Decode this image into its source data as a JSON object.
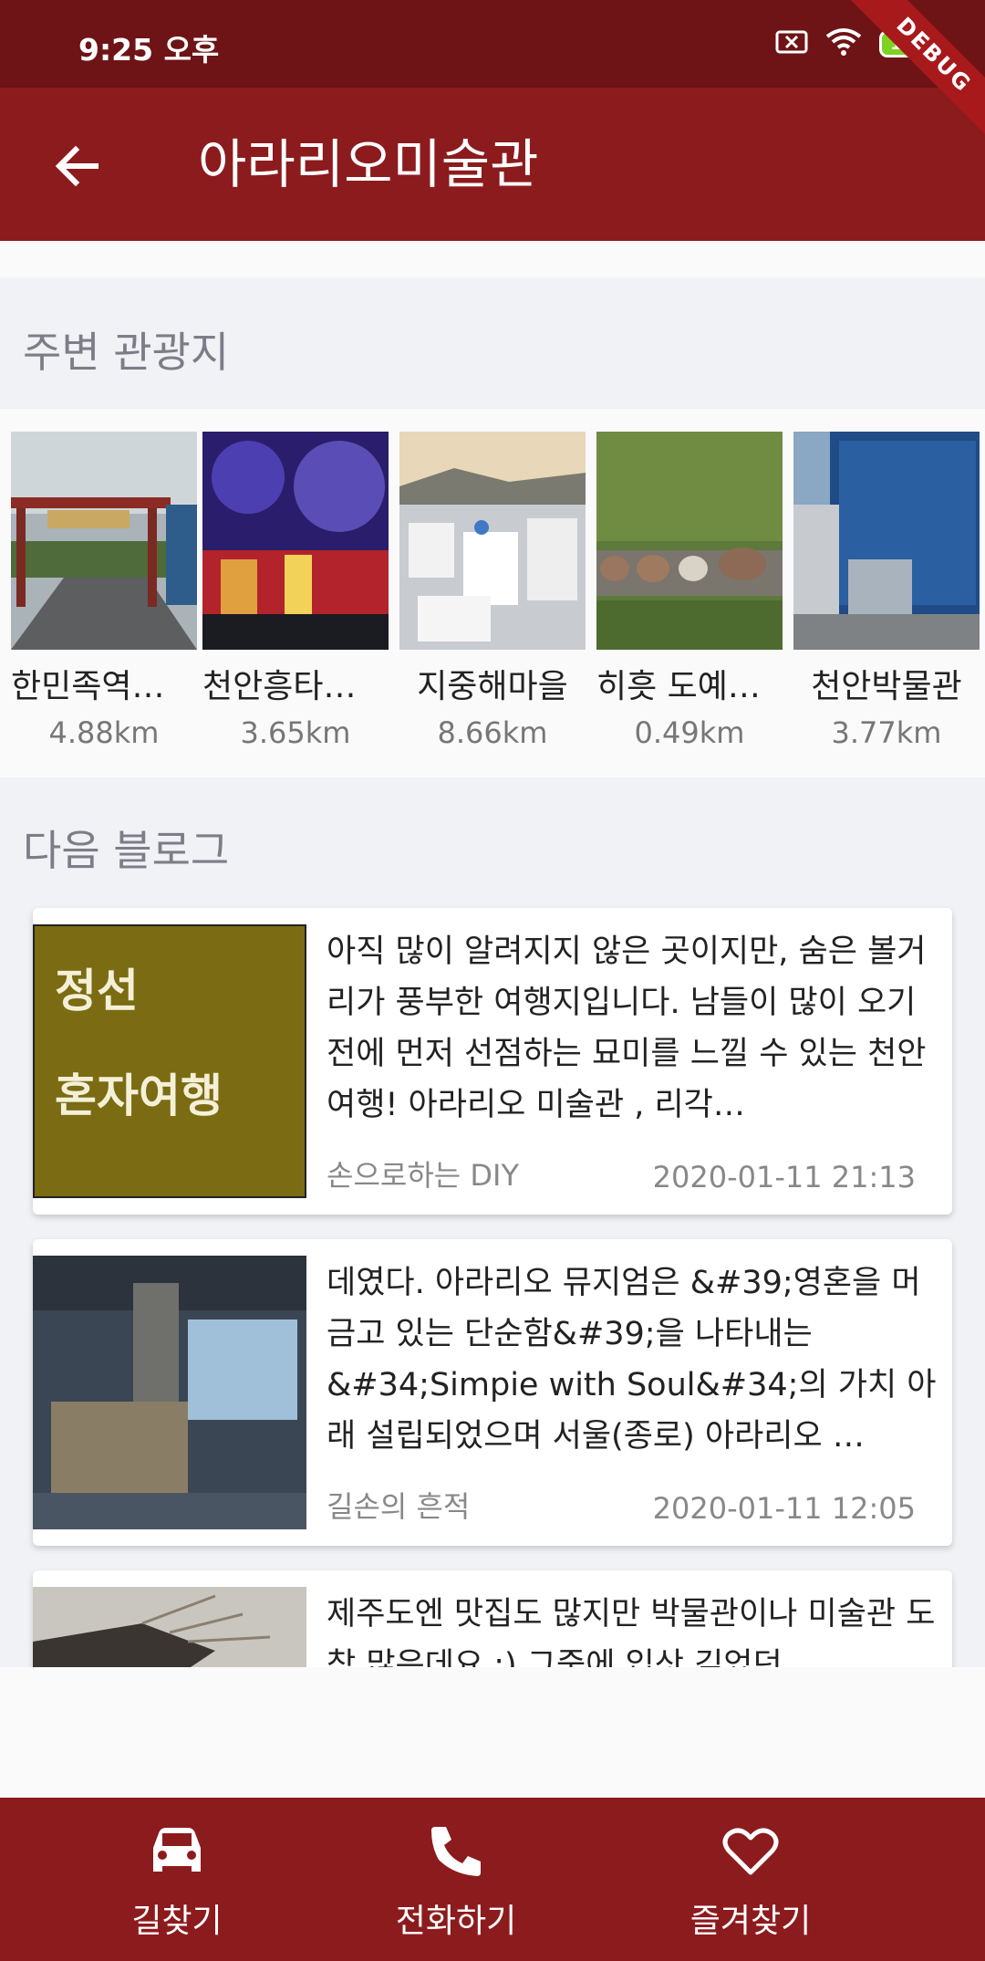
{
  "status": {
    "time": "9:25 오후",
    "battery": "100"
  },
  "debug_banner": "DEBUG",
  "app_bar": {
    "title": "아라리오미술관",
    "back_icon": "arrow-back-icon"
  },
  "nearby": {
    "title": "주변 관광지",
    "items": [
      {
        "name": "한민족역…",
        "distance": "4.88km"
      },
      {
        "name": "천안흥타…",
        "distance": "3.65km"
      },
      {
        "name": "지중해마을",
        "distance": "8.66km"
      },
      {
        "name": "히흣 도예…",
        "distance": "0.49km"
      },
      {
        "name": "천안박물관",
        "distance": "3.77km"
      }
    ]
  },
  "blogs": {
    "title": "다음 블로그",
    "items": [
      {
        "text": "아직 많이 알려지지 않은 곳이지만, 숨은 볼거리가 풍부한 여행지입니다. 남들이 많이 오기전에 먼저 선점하는 묘미를 느낄 수 있는 천안여행!  아라리오   미술관 , 리각…",
        "source": "손으로하는 DIY",
        "date": "2020-01-11 21:13",
        "thumb_text_1": "정선",
        "thumb_text_2": "혼자여행"
      },
      {
        "text": "데였다.     아라리오  뮤지엄은 &#39;영혼을 머금고 있는 단순함&#39;을 나타내는 &#34;Simpie with Soul&#34;의 가치 아래 설립되었으며 서울(종로)  아라리오  …",
        "source": "길손의 흔적",
        "date": "2020-01-11 12:05"
      },
      {
        "text": "제주도엔 맛집도 많지만 박물관이나  미술관 도 참 많은데요 :)  그중에 입삿 깊었던",
        "source": "",
        "date": ""
      }
    ]
  },
  "bottom_nav": {
    "items": [
      {
        "label": "길찾기",
        "icon": "car-icon"
      },
      {
        "label": "전화하기",
        "icon": "phone-icon"
      },
      {
        "label": "즐겨찾기",
        "icon": "heart-icon"
      }
    ]
  },
  "colors": {
    "primary": "#8c1b1e",
    "status_bar": "#6e1416",
    "background": "#f0f2f6"
  }
}
